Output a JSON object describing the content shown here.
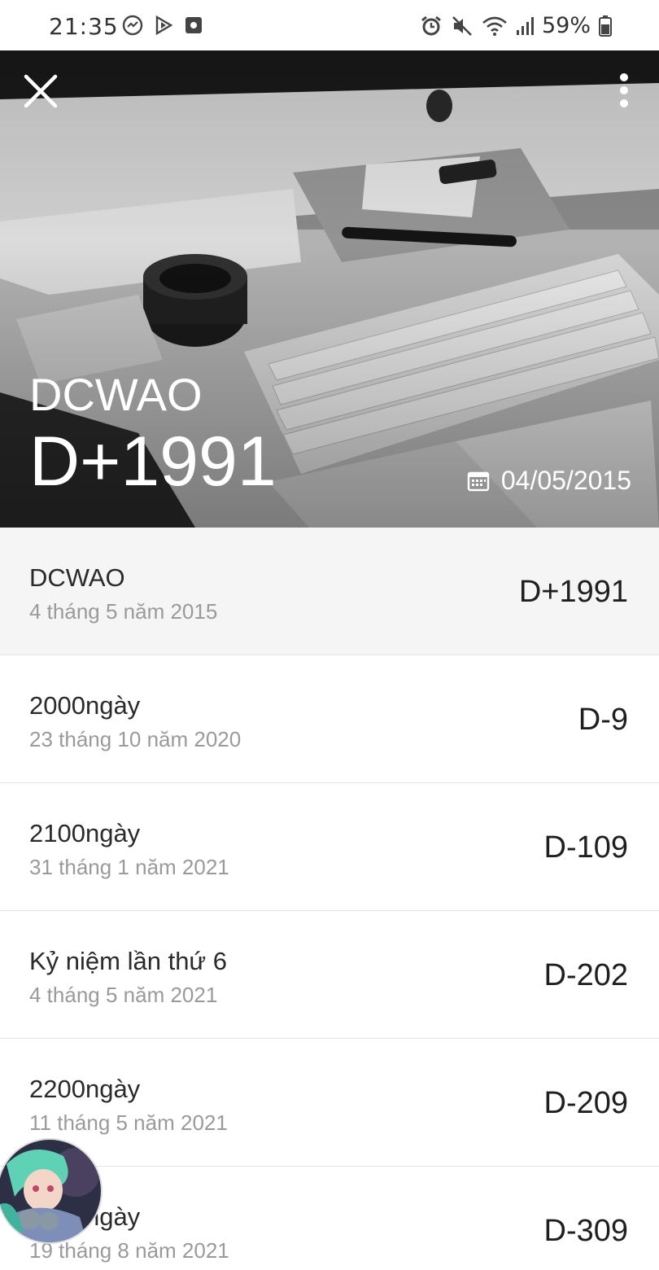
{
  "status": {
    "time": "21:35",
    "battery": "59%"
  },
  "hero": {
    "title": "DCWAO",
    "count": "D+1991",
    "date": "04/05/2015",
    "calendar_icon": "calendar-icon",
    "close_icon": "close-icon",
    "menu_icon": "more-vert-icon"
  },
  "events": [
    {
      "title": "DCWAO",
      "date": "4 tháng 5 năm 2015",
      "count": "D+1991"
    },
    {
      "title": "2000ngày",
      "date": "23 tháng 10 năm 2020",
      "count": "D-9"
    },
    {
      "title": "2100ngày",
      "date": "31 tháng 1 năm 2021",
      "count": "D-109"
    },
    {
      "title": "Kỷ niệm lần thứ 6",
      "date": "4 tháng 5 năm 2021",
      "count": "D-202"
    },
    {
      "title": "2200ngày",
      "date": "11 tháng 5 năm 2021",
      "count": "D-209"
    },
    {
      "title": "2300ngày",
      "date": "19 tháng 8 năm 2021",
      "count": "D-309"
    }
  ],
  "colors": {
    "highlight_row": "#f5f5f5",
    "secondary_text": "#9a9a9a"
  }
}
